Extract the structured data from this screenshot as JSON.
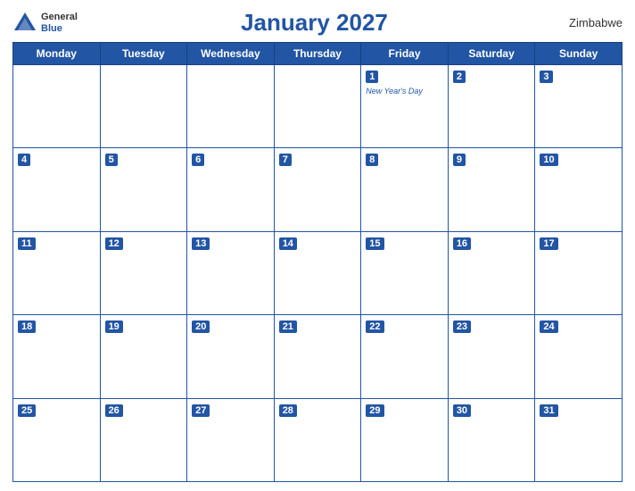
{
  "header": {
    "logo_general": "General",
    "logo_blue": "Blue",
    "title": "January 2027",
    "country": "Zimbabwe"
  },
  "calendar": {
    "days_of_week": [
      "Monday",
      "Tuesday",
      "Wednesday",
      "Thursday",
      "Friday",
      "Saturday",
      "Sunday"
    ],
    "weeks": [
      [
        {
          "day": "",
          "holiday": ""
        },
        {
          "day": "",
          "holiday": ""
        },
        {
          "day": "",
          "holiday": ""
        },
        {
          "day": "",
          "holiday": ""
        },
        {
          "day": "1",
          "holiday": "New Year's Day"
        },
        {
          "day": "2",
          "holiday": ""
        },
        {
          "day": "3",
          "holiday": ""
        }
      ],
      [
        {
          "day": "4",
          "holiday": ""
        },
        {
          "day": "5",
          "holiday": ""
        },
        {
          "day": "6",
          "holiday": ""
        },
        {
          "day": "7",
          "holiday": ""
        },
        {
          "day": "8",
          "holiday": ""
        },
        {
          "day": "9",
          "holiday": ""
        },
        {
          "day": "10",
          "holiday": ""
        }
      ],
      [
        {
          "day": "11",
          "holiday": ""
        },
        {
          "day": "12",
          "holiday": ""
        },
        {
          "day": "13",
          "holiday": ""
        },
        {
          "day": "14",
          "holiday": ""
        },
        {
          "day": "15",
          "holiday": ""
        },
        {
          "day": "16",
          "holiday": ""
        },
        {
          "day": "17",
          "holiday": ""
        }
      ],
      [
        {
          "day": "18",
          "holiday": ""
        },
        {
          "day": "19",
          "holiday": ""
        },
        {
          "day": "20",
          "holiday": ""
        },
        {
          "day": "21",
          "holiday": ""
        },
        {
          "day": "22",
          "holiday": ""
        },
        {
          "day": "23",
          "holiday": ""
        },
        {
          "day": "24",
          "holiday": ""
        }
      ],
      [
        {
          "day": "25",
          "holiday": ""
        },
        {
          "day": "26",
          "holiday": ""
        },
        {
          "day": "27",
          "holiday": ""
        },
        {
          "day": "28",
          "holiday": ""
        },
        {
          "day": "29",
          "holiday": ""
        },
        {
          "day": "30",
          "holiday": ""
        },
        {
          "day": "31",
          "holiday": ""
        }
      ]
    ]
  }
}
